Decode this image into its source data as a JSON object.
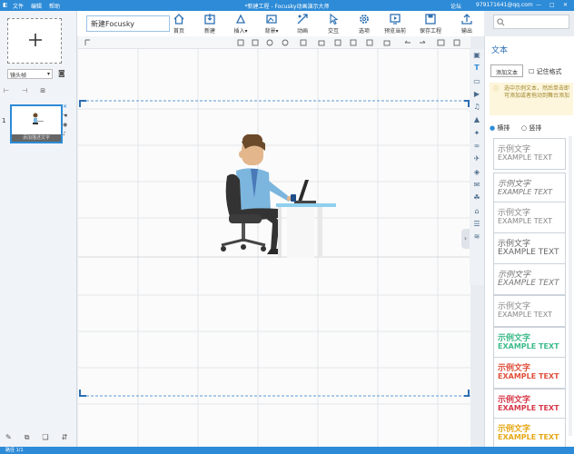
{
  "titlebar": {
    "menu": [
      "文件",
      "编辑",
      "帮助"
    ],
    "title": "*新建工程 - Focusky动画演示大师",
    "forum": "论坛",
    "account": "979171641@qq.com",
    "colors": {
      "bar": "#2d8bd7"
    }
  },
  "toolbar": {
    "project_name": "新建Focusky",
    "buttons": [
      {
        "label": "首页",
        "icon": "home-icon"
      },
      {
        "label": "新建",
        "icon": "new-icon"
      },
      {
        "label": "插入",
        "icon": "insert-icon"
      },
      {
        "label": "背景",
        "icon": "background-icon"
      },
      {
        "label": "动画",
        "icon": "animation-icon"
      },
      {
        "label": "交互",
        "icon": "interaction-icon"
      },
      {
        "label": "选项",
        "icon": "settings-icon"
      },
      {
        "label": "预览当前",
        "icon": "preview-icon"
      },
      {
        "label": "保存工程",
        "icon": "save-icon"
      },
      {
        "label": "输出",
        "icon": "export-icon"
      }
    ]
  },
  "leftpanel": {
    "frame_select": "镜头帧",
    "slide_number": "1",
    "thumb_caption": "添加描述文字"
  },
  "rightpanel": {
    "title": "文本",
    "add_text": "添加文本",
    "remember_format": "记住格式",
    "tip": "选中示例文本，然后单击即可添加或者拖动到舞台添加",
    "horizontal": "横排",
    "vertical": "竖排",
    "samples": [
      {
        "cn": "示例文字",
        "en": "EXAMPLE TEXT",
        "color": "#888888"
      },
      {
        "cn": "示例文字",
        "en": "EXAMPLE TEXT",
        "color": "#777777"
      },
      {
        "cn": "示例文字",
        "en": "EXAMPLE TEXT",
        "color": "#888888"
      },
      {
        "cn": "示例文字",
        "en": "EXAMPLE TEXT",
        "color": "#666666"
      },
      {
        "cn": "示例文字",
        "en": "EXAMPLE TEXT",
        "color": "#777777"
      },
      {
        "cn": "示例文字",
        "en": "EXAMPLE TEXT",
        "color": "#888888"
      },
      {
        "cn": "示例文字",
        "en": "EXAMPLE TEXT",
        "color": "#3dbb8a"
      },
      {
        "cn": "示例文字",
        "en": "EXAMPLE TEXT",
        "color": "#e0503c"
      },
      {
        "cn": "示例文字",
        "en": "EXAMPLE TEXT",
        "color": "#d63a4a"
      },
      {
        "cn": "示例文字",
        "en": "EXAMPLE TEXT",
        "color": "#e6a817"
      }
    ]
  },
  "statusbar": {
    "pages": "路径 1/1"
  }
}
